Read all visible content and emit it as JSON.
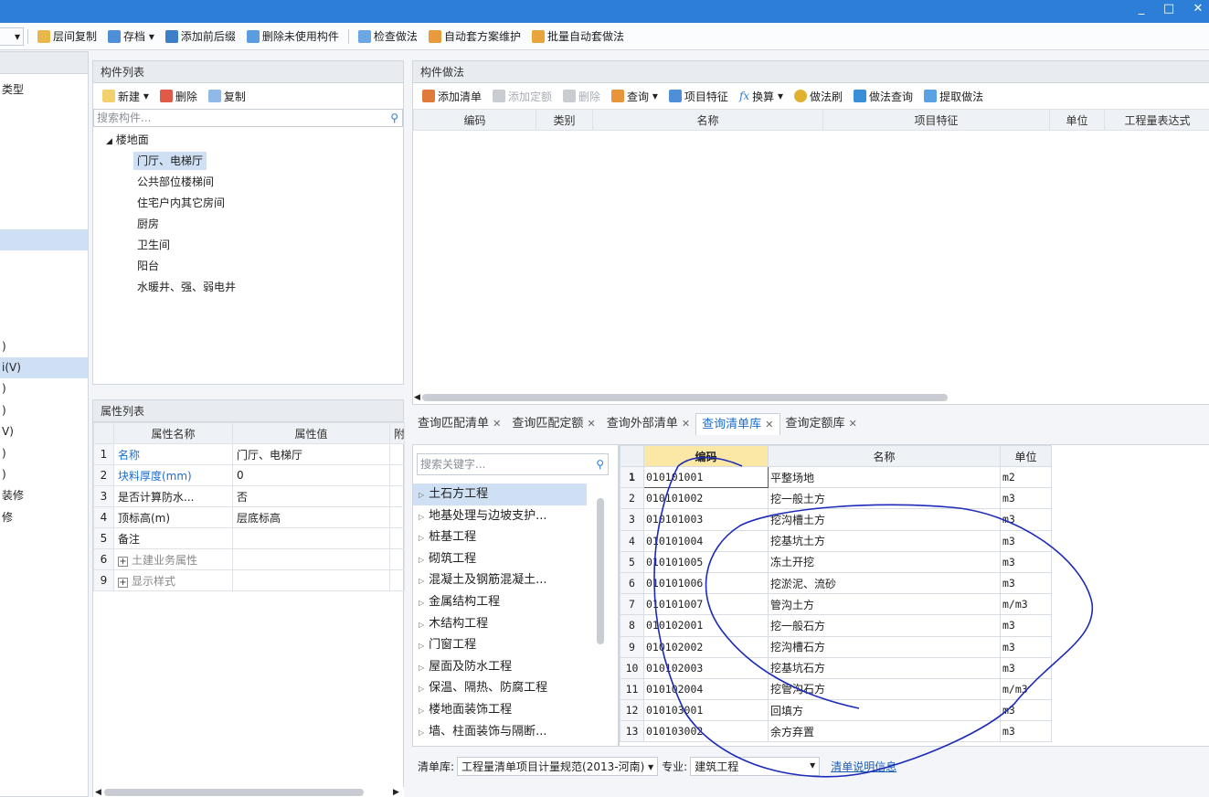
{
  "window": {
    "minimize": "_",
    "restore": "□",
    "close": "✕"
  },
  "toolbar": {
    "items": [
      "层间复制",
      "存档",
      "添加前后缀",
      "删除未使用构件",
      "检查做法",
      "自动套方案维护",
      "批量自动套做法"
    ],
    "archive_dropdown": "▾"
  },
  "left_strip": {
    "items": [
      "类型",
      "",
      "",
      "",
      "",
      "",
      "",
      "",
      "",
      "",
      "",
      "",
      ")",
      "i(V)",
      ")",
      ")",
      "V)",
      ")",
      ")",
      "装修",
      "修"
    ]
  },
  "component_list": {
    "title": "构件列表",
    "tools": [
      "新建",
      "删除",
      "复制"
    ],
    "search_placeholder": "搜索构件...",
    "root": "楼地面",
    "items": [
      "门厅、电梯厅",
      "公共部位楼梯间",
      "住宅户内其它房间",
      "厨房",
      "卫生间",
      "阳台",
      "水暖井、强、弱电井"
    ]
  },
  "property_list": {
    "title": "属性列表",
    "headers": [
      "属性名称",
      "属性值",
      "附"
    ],
    "rows": [
      {
        "no": "1",
        "name": "名称",
        "value": "门厅、电梯厅"
      },
      {
        "no": "2",
        "name": "块料厚度(mm)",
        "value": "0"
      },
      {
        "no": "3",
        "name": "是否计算防水...",
        "value": "否"
      },
      {
        "no": "4",
        "name": "顶标高(m)",
        "value": "层底标高"
      },
      {
        "no": "5",
        "name": "备注",
        "value": ""
      },
      {
        "no": "6",
        "name": "土建业务属性",
        "value": ""
      },
      {
        "no": "9",
        "name": "显示样式",
        "value": ""
      }
    ]
  },
  "method_panel": {
    "title": "构件做法",
    "tools": [
      "添加清单",
      "添加定额",
      "删除",
      "查询",
      "项目特征",
      "换算",
      "做法刷",
      "做法查询",
      "提取做法"
    ],
    "headers": [
      "编码",
      "类别",
      "名称",
      "项目特征",
      "单位",
      "工程量表达式"
    ]
  },
  "query_tabs": {
    "tabs": [
      "查询匹配清单",
      "查询匹配定额",
      "查询外部清单",
      "查询清单库",
      "查询定额库"
    ],
    "active": 3,
    "close": "✕"
  },
  "query_library": {
    "search_placeholder": "搜索关键字...",
    "categories": [
      "土石方工程",
      "地基处理与边坡支护...",
      "桩基工程",
      "砌筑工程",
      "混凝土及钢筋混凝土...",
      "金属结构工程",
      "木结构工程",
      "门窗工程",
      "屋面及防水工程",
      "保温、隔热、防腐工程",
      "楼地面装饰工程",
      "墙、柱面装饰与隔断..."
    ],
    "headers": [
      "编码",
      "名称",
      "单位"
    ],
    "rows": [
      {
        "no": "1",
        "code": "010101001",
        "name": "平整场地",
        "unit": "m2"
      },
      {
        "no": "2",
        "code": "010101002",
        "name": "挖一般土方",
        "unit": "m3"
      },
      {
        "no": "3",
        "code": "010101003",
        "name": "挖沟槽土方",
        "unit": "m3"
      },
      {
        "no": "4",
        "code": "010101004",
        "name": "挖基坑土方",
        "unit": "m3"
      },
      {
        "no": "5",
        "code": "010101005",
        "name": "冻土开挖",
        "unit": "m3"
      },
      {
        "no": "6",
        "code": "010101006",
        "name": "挖淤泥、流砂",
        "unit": "m3"
      },
      {
        "no": "7",
        "code": "010101007",
        "name": "管沟土方",
        "unit": "m/m3"
      },
      {
        "no": "8",
        "code": "010102001",
        "name": "挖一般石方",
        "unit": "m3"
      },
      {
        "no": "9",
        "code": "010102002",
        "name": "挖沟槽石方",
        "unit": "m3"
      },
      {
        "no": "10",
        "code": "010102003",
        "name": "挖基坑石方",
        "unit": "m3"
      },
      {
        "no": "11",
        "code": "010102004",
        "name": "挖管沟石方",
        "unit": "m/m3"
      },
      {
        "no": "12",
        "code": "010103001",
        "name": "回填方",
        "unit": "m3"
      },
      {
        "no": "13",
        "code": "010103002",
        "name": "余方弃置",
        "unit": "m3"
      }
    ],
    "footer": {
      "library_label": "清单库:",
      "library_value": "工程量清单项目计量规范(2013-河南)",
      "specialty_label": "专业:",
      "specialty_value": "建筑工程",
      "info_link": "清单说明信息"
    }
  },
  "colors": {
    "accent": "#2c7ed6",
    "selection": "#cfe0f5",
    "highlight_header": "#fbe8a6",
    "annotation": "#1c2bb8"
  }
}
